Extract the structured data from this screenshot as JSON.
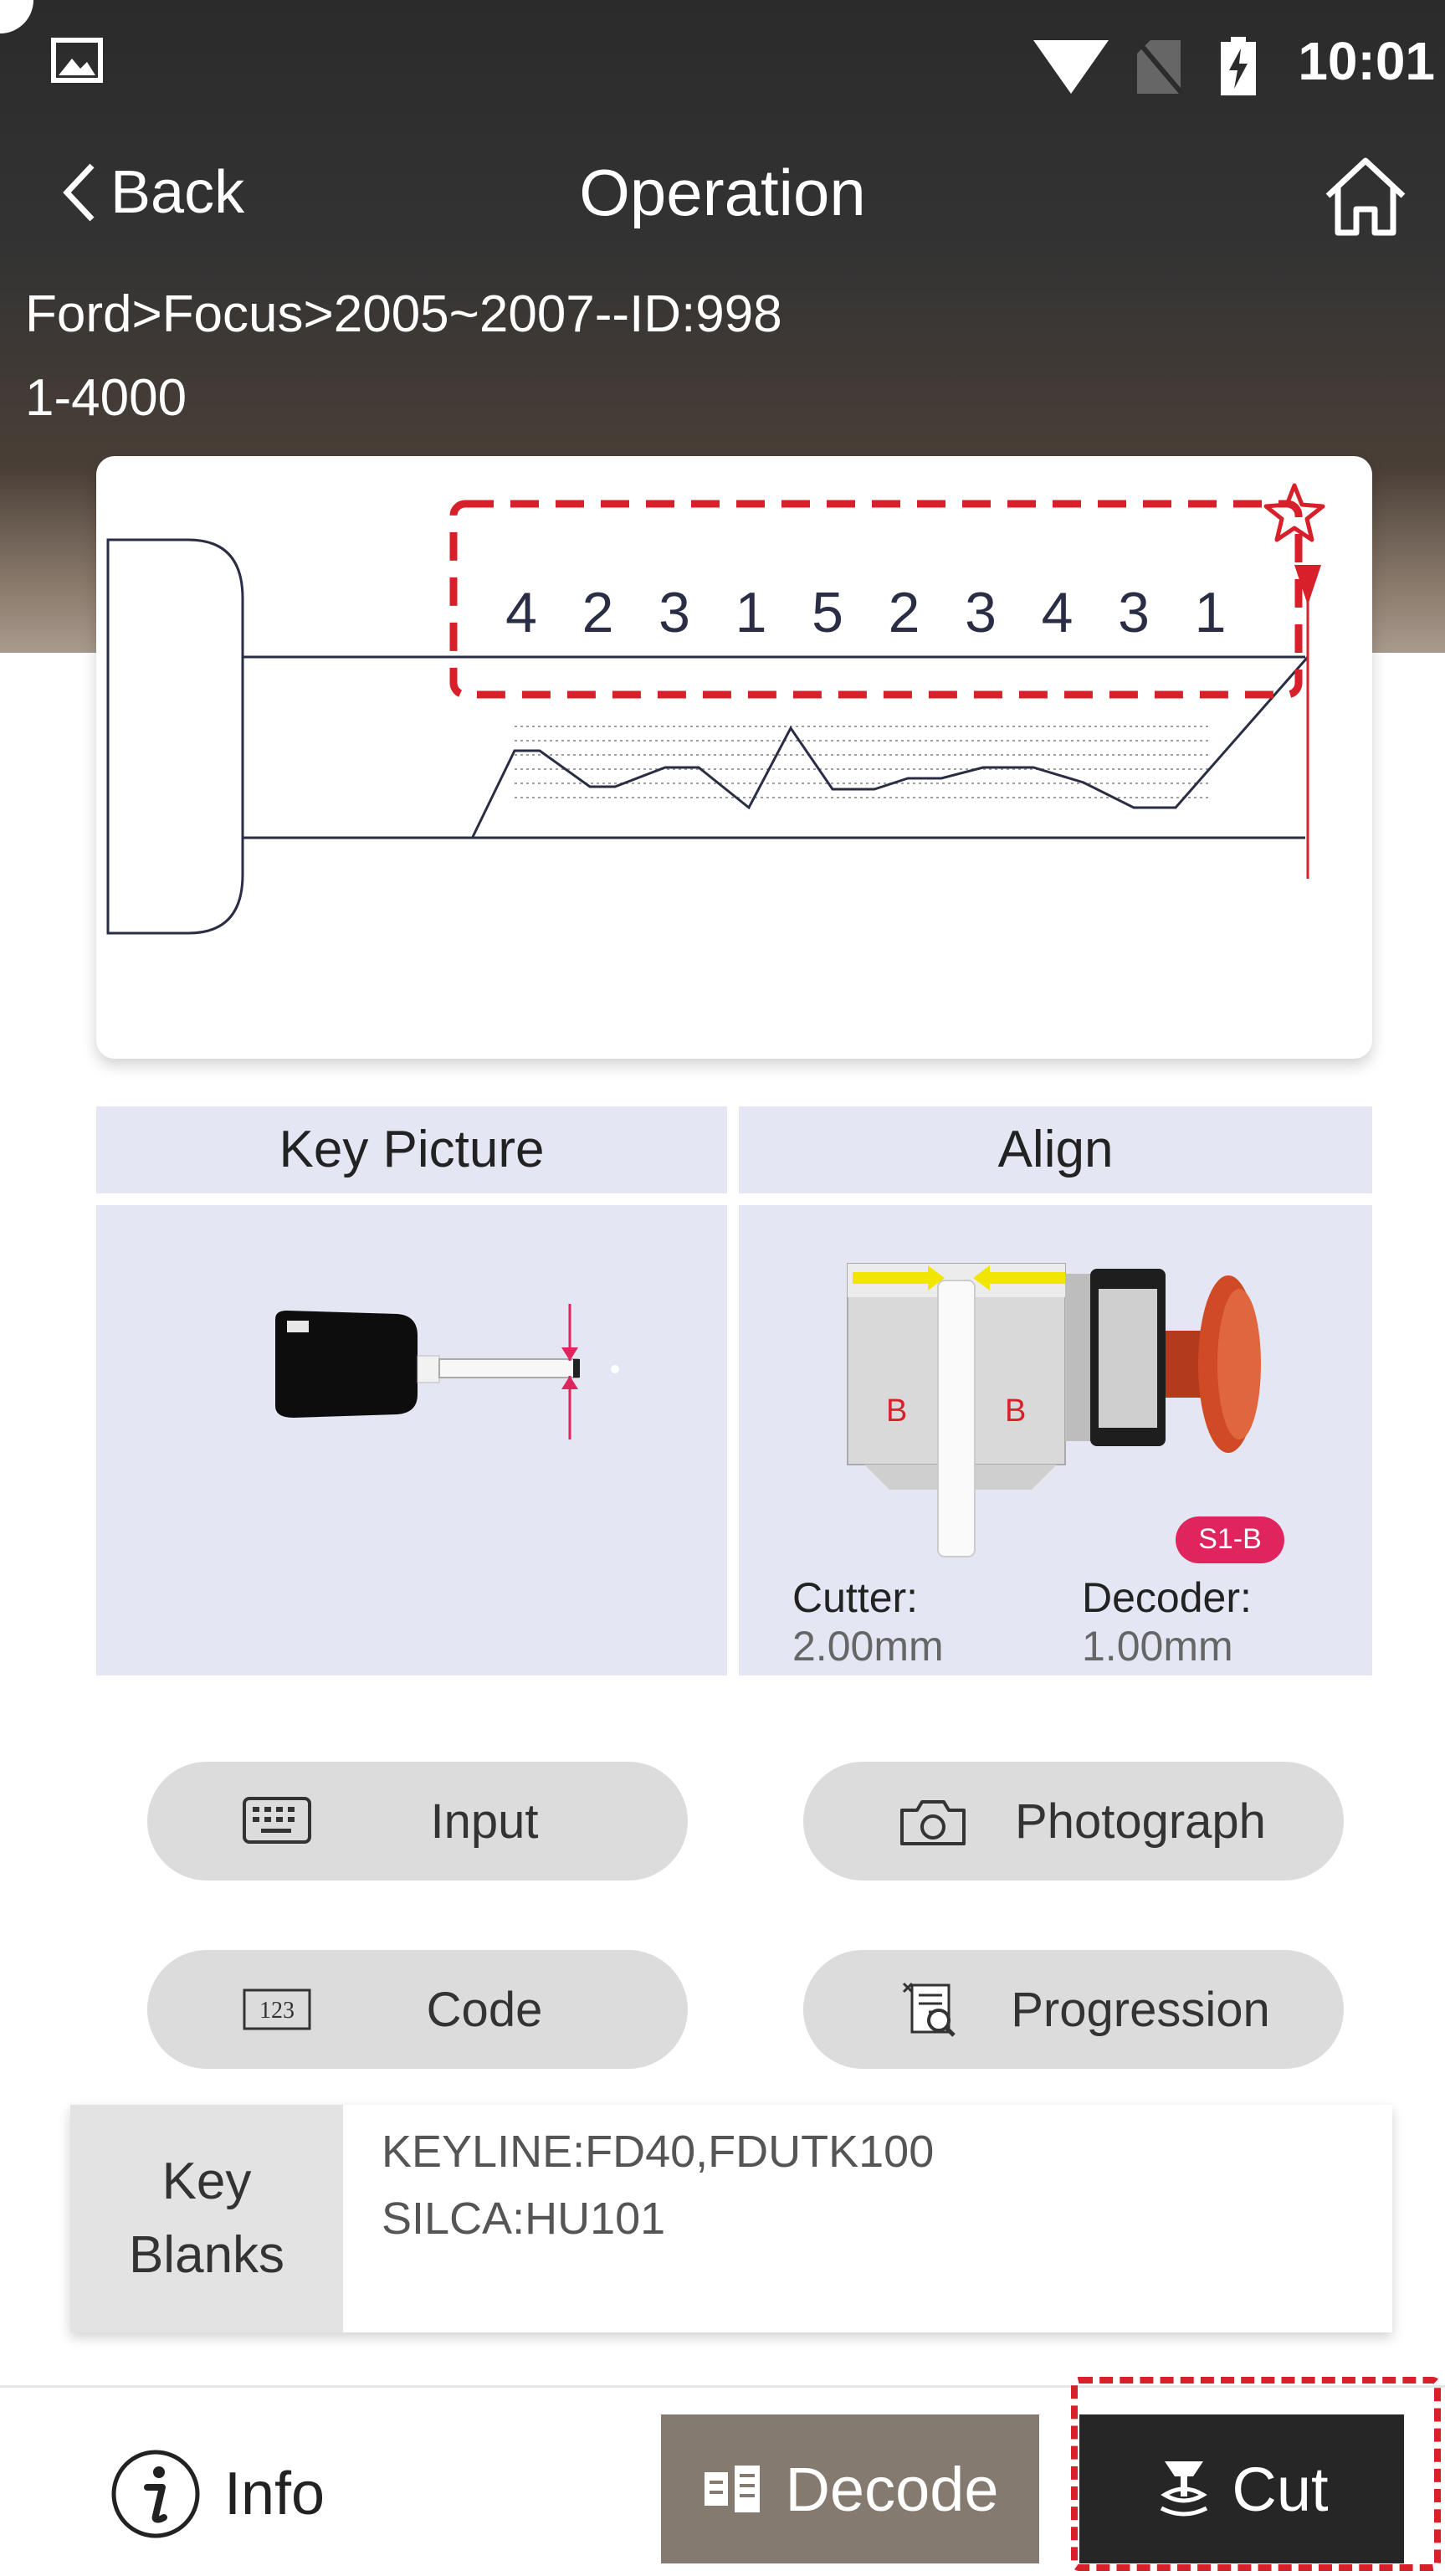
{
  "status_bar": {
    "time": "10:01",
    "icons": [
      "image-icon",
      "wifi-icon",
      "no-sim-icon",
      "battery-charging-icon"
    ]
  },
  "nav": {
    "back_label": "Back",
    "title": "Operation",
    "home_icon": "home-icon"
  },
  "key_info": {
    "breadcrumb": "Ford>Focus>2005~2007--ID:998",
    "range": "1-4000"
  },
  "cut_code": {
    "digits": [
      "4",
      "2",
      "3",
      "1",
      "5",
      "2",
      "3",
      "4",
      "3",
      "1"
    ],
    "favorite_icon": "star-icon"
  },
  "panels": {
    "key_picture": {
      "title": "Key Picture"
    },
    "align": {
      "title": "Align",
      "badge": "S1-B",
      "jaw_marks": [
        "B",
        "B"
      ],
      "cutter_label": "Cutter:",
      "cutter_value": "2.00mm",
      "decoder_label": "Decoder:",
      "decoder_value": "1.00mm"
    }
  },
  "actions": {
    "input": "Input",
    "photograph": "Photograph",
    "code": "Code",
    "code_icon_text": "123",
    "progression": "Progression"
  },
  "key_blanks": {
    "label_line1": "Key",
    "label_line2": "Blanks",
    "lines": [
      "KEYLINE:FD40,FDUTK100",
      "SILCA:HU101"
    ]
  },
  "bottom": {
    "info": "Info",
    "decode": "Decode",
    "cut": "Cut"
  },
  "colors": {
    "accent_red": "#d8202a",
    "decode_bg": "#857a70",
    "cut_bg": "#262626",
    "panel_bg": "#e4e6f4"
  }
}
